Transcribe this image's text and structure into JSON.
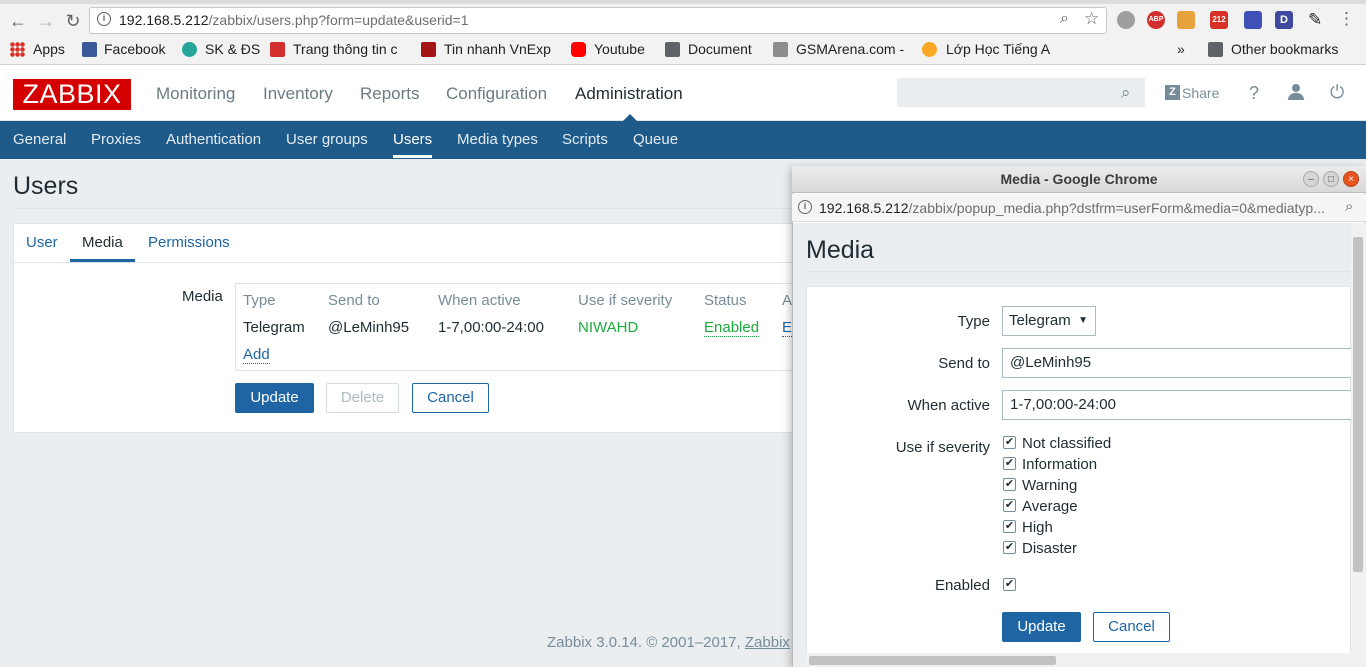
{
  "browser": {
    "url_host": "192.168.5.212",
    "url_path": "/zabbix/users.php?form=update&userid=1",
    "bookmarks": [
      "Apps",
      "Facebook",
      "SK & ĐS",
      "Trang thông tin c",
      "Tin nhanh VnExp",
      "Youtube",
      "Document",
      "GSMArena.com -",
      "Lớp Học Tiếng A"
    ],
    "bookmarks_more": "»",
    "other_bookmarks": "Other bookmarks",
    "ext_badges": [
      "ABP",
      "212",
      "D"
    ]
  },
  "header": {
    "logo": "ZABBIX",
    "menu": [
      "Monitoring",
      "Inventory",
      "Reports",
      "Configuration",
      "Administration"
    ],
    "share": "Share",
    "help": "?"
  },
  "subnav": [
    "General",
    "Proxies",
    "Authentication",
    "User groups",
    "Users",
    "Media types",
    "Scripts",
    "Queue"
  ],
  "page": {
    "title": "Users",
    "tabs": [
      "User",
      "Media",
      "Permissions"
    ],
    "media_label": "Media",
    "table_headers": [
      "Type",
      "Send to",
      "When active",
      "Use if severity",
      "Status",
      "A"
    ],
    "row": {
      "type": "Telegram",
      "send_to": "@LeMinh95",
      "when_active": "1-7,00:00-24:00",
      "severity": "NIWAHD",
      "status": "Enabled",
      "action": "E"
    },
    "add_link": "Add",
    "buttons": {
      "update": "Update",
      "delete": "Delete",
      "cancel": "Cancel"
    },
    "footer": "Zabbix 3.0.14. © 2001–2017, ",
    "footer_link": "Zabbix"
  },
  "popup": {
    "window_title": "Media - Google Chrome",
    "url_host": "192.168.5.212",
    "url_path": "/zabbix/popup_media.php?dstfrm=userForm&media=0&mediatyp...",
    "title": "Media",
    "labels": {
      "type": "Type",
      "send_to": "Send to",
      "when_active": "When active",
      "severity": "Use if severity",
      "enabled": "Enabled"
    },
    "type_value": "Telegram",
    "send_to_value": "@LeMinh95",
    "when_active_value": "1-7,00:00-24:00",
    "severities": [
      "Not classified",
      "Information",
      "Warning",
      "Average",
      "High",
      "Disaster"
    ],
    "check": "✔",
    "buttons": {
      "update": "Update",
      "cancel": "Cancel"
    }
  }
}
